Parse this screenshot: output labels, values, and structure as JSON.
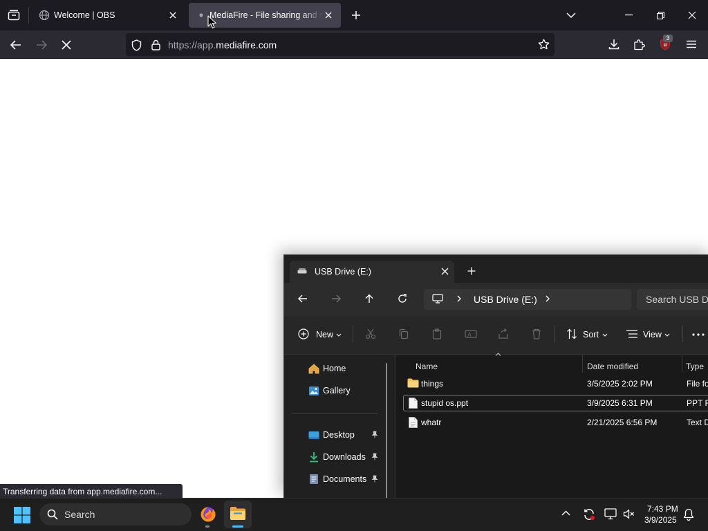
{
  "browser": {
    "tabs": [
      {
        "title": "Welcome | OBS"
      },
      {
        "title": "MediaFire - File sharing and storage"
      }
    ],
    "url_prefix": "https://app.",
    "url_domain": "mediafire.com",
    "extension_badge": "3",
    "status_text": "Transferring data from app.mediafire.com..."
  },
  "explorer": {
    "tab_title": "USB Drive (E:)",
    "breadcrumb": "USB Drive (E:)",
    "search_placeholder": "Search USB Dr",
    "commands": {
      "new": "New",
      "sort": "Sort",
      "view": "View"
    },
    "sidebar": [
      {
        "label": "Home",
        "icon": "home-icon"
      },
      {
        "label": "Gallery",
        "icon": "gallery-icon"
      },
      {
        "label": "Desktop",
        "icon": "desktop-folder-icon"
      },
      {
        "label": "Downloads",
        "icon": "downloads-folder-icon"
      },
      {
        "label": "Documents",
        "icon": "documents-folder-icon"
      }
    ],
    "columns": {
      "name": "Name",
      "date": "Date modified",
      "type": "Type"
    },
    "files": [
      {
        "name": "things",
        "date": "3/5/2025 2:02 PM",
        "type": "File fo"
      },
      {
        "name": "stupid os.ppt",
        "date": "3/9/2025 6:31 PM",
        "type": "PPT F"
      },
      {
        "name": "whatr",
        "date": "2/21/2025 6:56 PM",
        "type": "Text D"
      }
    ]
  },
  "taskbar": {
    "search_label": "Search",
    "time": "7:43 PM",
    "date": "3/9/2025"
  },
  "colors": {
    "tabbar_bg": "#1c1b22",
    "toolbar_bg": "#2b2a33",
    "explorer_bg": "#202020",
    "folder_yellow": "#f2c14e",
    "accent_blue": "#0078d4"
  }
}
